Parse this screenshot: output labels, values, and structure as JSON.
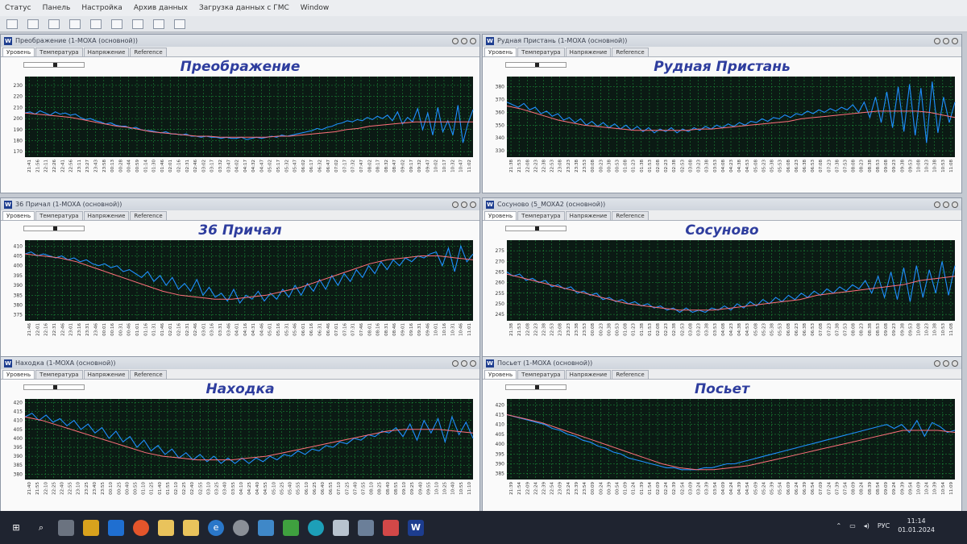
{
  "menu": [
    "Статус",
    "Панель",
    "Настройка",
    "Архив данных",
    "Загрузка данных с ГМС",
    "Window"
  ],
  "tabs": [
    "Уровень",
    "Температура",
    "Напряжение",
    "Reference"
  ],
  "colors": {
    "plot_bg": "#0b1a14",
    "grid": "#1f9d3f",
    "raw": "#1e8fff",
    "smooth": "#ff6f7a",
    "title": "#2e3d9e"
  },
  "windows": [
    {
      "id": "preobrazhenie",
      "window_title": "Преображение (1-MOXA (основной))",
      "station": "Преображение"
    },
    {
      "id": "rudnaya",
      "window_title": "Рудная Пристань (1-MOXA (основной))",
      "station": "Рудная Пристань"
    },
    {
      "id": "prichal36",
      "window_title": "36 Причал (1-MOXA (основной))",
      "station": "36 Причал"
    },
    {
      "id": "sosunovo",
      "window_title": "Сосуново (5_MOXA2 (основной))",
      "station": "Сосуново"
    },
    {
      "id": "nakhodka",
      "window_title": "Находка (1-MOXA (основной))",
      "station": "Находка"
    },
    {
      "id": "posyet",
      "window_title": "Посьет (1-MOXA (основной))",
      "station": "Посьет"
    }
  ],
  "chart_data": [
    {
      "type": "line",
      "station": "Преображение",
      "yticks": [
        170,
        180,
        190,
        200,
        210,
        220,
        230
      ],
      "ylim": [
        165,
        238
      ],
      "x_labels": [
        "21:41",
        "21:56",
        "22:11",
        "22:26",
        "22:41",
        "22:56",
        "23:11",
        "23:27",
        "23:43",
        "23:58",
        "00:13",
        "00:28",
        "00:44",
        "00:59",
        "01:14",
        "01:30",
        "01:46",
        "02:01",
        "02:16",
        "02:31",
        "02:46",
        "03:02",
        "03:17",
        "03:32",
        "03:47",
        "04:02",
        "04:17",
        "04:32",
        "04:47",
        "05:02",
        "05:17",
        "05:32",
        "05:47",
        "06:02",
        "06:17",
        "06:32",
        "06:47",
        "07:02",
        "07:17",
        "07:32",
        "07:47",
        "08:02",
        "08:17",
        "08:32",
        "08:47",
        "09:02",
        "09:17",
        "09:32",
        "09:47",
        "10:02",
        "10:17",
        "10:32",
        "10:47",
        "11:02"
      ],
      "series": [
        {
          "values": [
            205,
            206,
            204,
            207,
            205,
            203,
            206,
            204,
            205,
            203,
            204,
            201,
            199,
            200,
            198,
            197,
            195,
            196,
            194,
            193,
            193,
            191,
            192,
            190,
            189,
            189,
            188,
            187,
            188,
            186,
            186,
            185,
            186,
            184,
            184,
            183,
            184,
            183,
            183,
            182,
            183,
            182,
            182,
            183,
            181,
            182,
            183,
            182,
            183,
            184,
            183,
            185,
            184,
            185,
            186,
            187,
            188,
            189,
            191,
            190,
            192,
            193,
            195,
            196,
            198,
            197,
            199,
            198,
            201,
            199,
            202,
            200,
            203,
            198,
            206,
            195,
            201,
            197,
            209,
            190,
            205,
            185,
            210,
            188,
            198,
            185,
            212,
            178,
            196,
            208
          ]
        },
        {
          "values": [
            205,
            204,
            203,
            202,
            201,
            199,
            197,
            195,
            193,
            192,
            190,
            188,
            187,
            186,
            185,
            184,
            184,
            183,
            183,
            183,
            183,
            183,
            184,
            184,
            185,
            186,
            187,
            188,
            190,
            191,
            193,
            194,
            195,
            196,
            197,
            197,
            197,
            197,
            197,
            197
          ]
        }
      ]
    },
    {
      "type": "line",
      "station": "Рудная Пристань",
      "yticks": [
        330,
        340,
        350,
        360,
        370,
        380
      ],
      "ylim": [
        325,
        388
      ],
      "x_labels": [
        "21:38",
        "21:53",
        "22:08",
        "22:23",
        "22:38",
        "22:53",
        "23:08",
        "23:23",
        "23:38",
        "23:53",
        "00:08",
        "00:23",
        "00:38",
        "00:53",
        "01:08",
        "01:23",
        "01:38",
        "01:53",
        "02:08",
        "02:23",
        "02:38",
        "02:53",
        "03:08",
        "03:23",
        "03:38",
        "03:53",
        "04:08",
        "04:23",
        "04:38",
        "04:53",
        "05:08",
        "05:23",
        "05:38",
        "05:53",
        "06:08",
        "06:23",
        "06:38",
        "06:53",
        "07:08",
        "07:23",
        "07:38",
        "07:53",
        "08:08",
        "08:23",
        "08:38",
        "08:53",
        "09:08",
        "09:23",
        "09:38",
        "09:53",
        "10:08",
        "10:23",
        "10:38",
        "10:53",
        "11:08"
      ],
      "series": [
        {
          "values": [
            368,
            366,
            364,
            367,
            362,
            364,
            359,
            361,
            357,
            359,
            354,
            356,
            352,
            355,
            350,
            353,
            349,
            352,
            348,
            351,
            347,
            350,
            346,
            349,
            345,
            348,
            344,
            347,
            345,
            348,
            344,
            347,
            345,
            348,
            346,
            349,
            347,
            350,
            348,
            351,
            349,
            352,
            350,
            353,
            352,
            355,
            353,
            356,
            355,
            358,
            356,
            359,
            358,
            361,
            359,
            362,
            360,
            363,
            361,
            364,
            362,
            366,
            360,
            368,
            356,
            372,
            352,
            376,
            348,
            380,
            345,
            382,
            342,
            379,
            336,
            384,
            344,
            372,
            352,
            368
          ]
        },
        {
          "values": [
            365,
            363,
            360,
            357,
            354,
            352,
            350,
            349,
            348,
            347,
            346,
            346,
            346,
            346,
            346,
            347,
            347,
            348,
            349,
            350,
            351,
            352,
            353,
            355,
            356,
            357,
            358,
            359,
            360,
            361,
            361,
            361,
            361,
            360,
            358,
            356
          ]
        }
      ]
    },
    {
      "type": "line",
      "station": "36 Причал",
      "yticks": [
        375,
        380,
        385,
        390,
        395,
        400,
        405,
        410
      ],
      "ylim": [
        372,
        413
      ],
      "x_labels": [
        "21:46",
        "22:01",
        "22:16",
        "22:31",
        "22:46",
        "23:01",
        "23:16",
        "23:31",
        "23:46",
        "00:01",
        "00:16",
        "00:31",
        "00:46",
        "01:01",
        "01:16",
        "01:31",
        "01:46",
        "02:01",
        "02:16",
        "02:31",
        "02:46",
        "03:01",
        "03:16",
        "03:31",
        "03:46",
        "04:01",
        "04:16",
        "04:31",
        "04:46",
        "05:01",
        "05:16",
        "05:31",
        "05:46",
        "06:01",
        "06:16",
        "06:31",
        "06:46",
        "07:01",
        "07:16",
        "07:31",
        "07:46",
        "08:01",
        "08:16",
        "08:31",
        "08:46",
        "09:01",
        "09:16",
        "09:31",
        "09:46",
        "10:01",
        "10:16",
        "10:31",
        "10:46",
        "11:01"
      ],
      "series": [
        {
          "values": [
            406,
            407,
            405,
            406,
            405,
            404,
            405,
            403,
            404,
            402,
            403,
            401,
            400,
            401,
            399,
            400,
            397,
            398,
            396,
            394,
            397,
            392,
            395,
            390,
            394,
            388,
            391,
            387,
            393,
            385,
            389,
            384,
            386,
            382,
            388,
            381,
            385,
            383,
            387,
            382,
            386,
            383,
            388,
            384,
            390,
            385,
            391,
            387,
            393,
            388,
            395,
            390,
            396,
            392,
            398,
            394,
            400,
            396,
            402,
            398,
            403,
            400,
            404,
            402,
            405,
            404,
            406,
            407,
            400,
            409,
            397,
            410,
            402,
            406
          ]
        },
        {
          "values": [
            406,
            405,
            404,
            402,
            399,
            396,
            393,
            390,
            387,
            385,
            384,
            383,
            383,
            384,
            385,
            387,
            389,
            392,
            395,
            398,
            401,
            403,
            404,
            405,
            405,
            404,
            403
          ]
        }
      ]
    },
    {
      "type": "line",
      "station": "Сосуново",
      "yticks": [
        245,
        250,
        255,
        260,
        265,
        270,
        275
      ],
      "ylim": [
        242,
        280
      ],
      "x_labels": [
        "21:38",
        "21:53",
        "22:08",
        "22:23",
        "22:38",
        "22:53",
        "23:08",
        "23:23",
        "23:38",
        "23:53",
        "00:08",
        "00:23",
        "00:38",
        "00:53",
        "01:08",
        "01:23",
        "01:38",
        "01:53",
        "02:08",
        "02:23",
        "02:38",
        "02:53",
        "03:08",
        "03:23",
        "03:38",
        "03:53",
        "04:08",
        "04:23",
        "04:38",
        "04:53",
        "05:08",
        "05:23",
        "05:38",
        "05:53",
        "06:08",
        "06:23",
        "06:38",
        "06:53",
        "07:08",
        "07:23",
        "07:38",
        "07:53",
        "08:08",
        "08:23",
        "08:38",
        "08:53",
        "09:08",
        "09:23",
        "09:38",
        "09:53",
        "10:08",
        "10:23",
        "10:38",
        "10:53",
        "11:08"
      ],
      "series": [
        {
          "values": [
            265,
            263,
            264,
            261,
            262,
            260,
            261,
            258,
            259,
            257,
            258,
            255,
            256,
            254,
            255,
            252,
            253,
            251,
            252,
            250,
            251,
            249,
            250,
            248,
            249,
            247,
            248,
            246,
            248,
            246,
            247,
            246,
            248,
            247,
            249,
            247,
            250,
            248,
            251,
            249,
            252,
            250,
            253,
            251,
            254,
            252,
            255,
            253,
            256,
            254,
            257,
            255,
            258,
            256,
            259,
            257,
            261,
            255,
            263,
            253,
            265,
            252,
            267,
            251,
            268,
            253,
            266,
            255,
            270,
            254,
            268
          ]
        },
        {
          "values": [
            264,
            262,
            260,
            258,
            256,
            254,
            252,
            250,
            249,
            248,
            247,
            247,
            247,
            248,
            249,
            250,
            251,
            252,
            254,
            255,
            256,
            257,
            258,
            259,
            261,
            262,
            263
          ]
        }
      ]
    },
    {
      "type": "line",
      "station": "Находка",
      "yticks": [
        380,
        385,
        390,
        395,
        400,
        405,
        410,
        415,
        420
      ],
      "ylim": [
        377,
        422
      ],
      "x_labels": [
        "21:40",
        "21:55",
        "22:10",
        "22:25",
        "22:40",
        "22:55",
        "23:10",
        "23:25",
        "23:40",
        "23:55",
        "00:10",
        "00:25",
        "00:40",
        "00:55",
        "01:10",
        "01:25",
        "01:40",
        "01:55",
        "02:10",
        "02:25",
        "02:40",
        "02:55",
        "03:10",
        "03:25",
        "03:40",
        "03:55",
        "04:10",
        "04:25",
        "04:40",
        "04:55",
        "05:10",
        "05:25",
        "05:40",
        "05:55",
        "06:10",
        "06:25",
        "06:40",
        "06:55",
        "07:10",
        "07:25",
        "07:40",
        "07:55",
        "08:10",
        "08:25",
        "08:40",
        "08:55",
        "09:10",
        "09:25",
        "09:40",
        "09:55",
        "10:10",
        "10:25",
        "10:40",
        "10:55",
        "11:10"
      ],
      "series": [
        {
          "values": [
            412,
            414,
            410,
            413,
            409,
            411,
            407,
            410,
            405,
            408,
            403,
            406,
            400,
            404,
            398,
            401,
            395,
            399,
            393,
            396,
            391,
            394,
            389,
            392,
            388,
            391,
            387,
            390,
            386,
            389,
            386,
            389,
            386,
            389,
            387,
            390,
            388,
            391,
            390,
            393,
            391,
            394,
            393,
            396,
            395,
            398,
            397,
            400,
            399,
            402,
            401,
            404,
            403,
            406,
            401,
            408,
            399,
            410,
            403,
            411,
            398,
            412,
            402,
            409,
            400
          ]
        },
        {
          "values": [
            412,
            410,
            407,
            404,
            401,
            398,
            395,
            392,
            390,
            389,
            388,
            388,
            388,
            389,
            390,
            392,
            394,
            396,
            398,
            400,
            402,
            404,
            405,
            405,
            405,
            404,
            403
          ]
        }
      ]
    },
    {
      "type": "line",
      "station": "Посьет",
      "yticks": [
        385,
        390,
        395,
        400,
        405,
        410,
        415,
        420
      ],
      "ylim": [
        382,
        423
      ],
      "x_labels": [
        "21:39",
        "21:54",
        "22:09",
        "22:24",
        "22:39",
        "22:54",
        "23:09",
        "23:24",
        "23:39",
        "23:54",
        "00:09",
        "00:24",
        "00:39",
        "00:54",
        "01:09",
        "01:24",
        "01:39",
        "01:54",
        "02:09",
        "02:24",
        "02:39",
        "02:54",
        "03:09",
        "03:24",
        "03:39",
        "03:54",
        "04:09",
        "04:24",
        "04:39",
        "04:54",
        "05:09",
        "05:24",
        "05:39",
        "05:54",
        "06:09",
        "06:24",
        "06:39",
        "06:54",
        "07:09",
        "07:24",
        "07:39",
        "07:54",
        "08:09",
        "08:24",
        "08:39",
        "08:54",
        "09:09",
        "09:24",
        "09:39",
        "09:54",
        "10:09",
        "10:24",
        "10:39",
        "10:54",
        "11:09"
      ],
      "series": [
        {
          "values": [
            415,
            414,
            413,
            412,
            411,
            410,
            408,
            407,
            405,
            404,
            402,
            401,
            399,
            398,
            396,
            395,
            393,
            392,
            391,
            390,
            389,
            388,
            388,
            387,
            387,
            387,
            388,
            388,
            389,
            390,
            390,
            391,
            392,
            393,
            394,
            395,
            396,
            397,
            398,
            399,
            400,
            401,
            402,
            403,
            404,
            405,
            406,
            407,
            408,
            409,
            410,
            408,
            410,
            406,
            412,
            404,
            411,
            409,
            406,
            407
          ]
        },
        {
          "values": [
            415,
            413,
            411,
            408,
            405,
            402,
            399,
            396,
            393,
            390,
            388,
            387,
            387,
            388,
            389,
            391,
            393,
            395,
            397,
            399,
            401,
            403,
            405,
            407,
            407,
            407,
            406
          ]
        }
      ]
    }
  ],
  "taskbar": {
    "lang": "РУС",
    "time": "11:14",
    "date": "01.01.2024"
  }
}
